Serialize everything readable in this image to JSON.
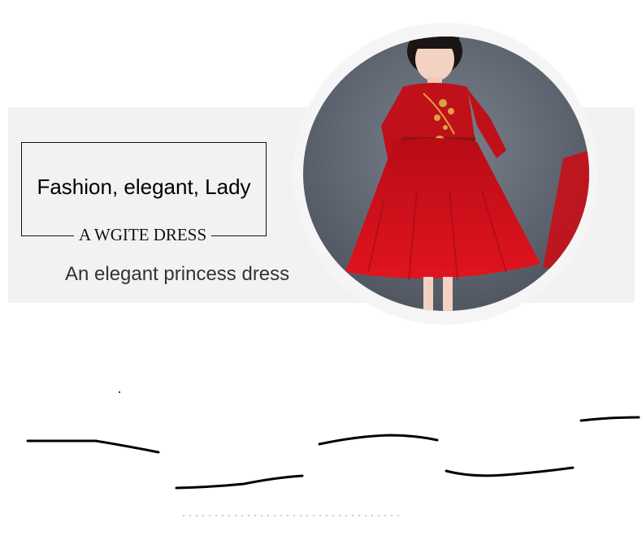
{
  "banner": {
    "headline": "Fashion, elegant, Lady",
    "tagline": "A WGITE DRESS",
    "subtitle": "An elegant princess dress"
  },
  "photo": {
    "subject": "girl-in-red-dress",
    "dress_color": "#c8101a",
    "background_color": "#5c6470"
  },
  "colors": {
    "banner_background": "#f2f2f2",
    "text_primary": "#000000",
    "text_secondary": "#333333"
  }
}
